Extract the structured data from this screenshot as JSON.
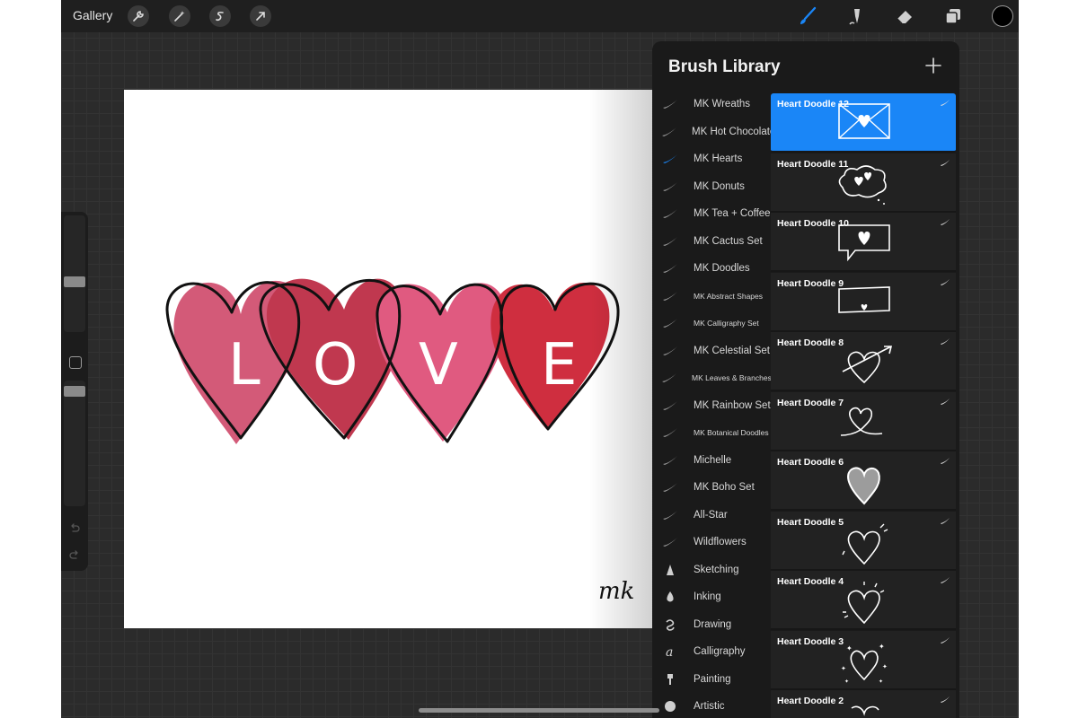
{
  "topbar": {
    "gallery_label": "Gallery",
    "left_tools": [
      "wrench-icon",
      "magic-wand-icon",
      "selection-icon",
      "transform-arrow-icon"
    ],
    "right_tools": [
      "brush-icon",
      "smudge-icon",
      "eraser-icon",
      "layers-icon"
    ],
    "active_tool": "brush-icon",
    "active_tool_color": "#1a86f7",
    "current_color": "#000000"
  },
  "sidebar": {
    "brush_size_level": 0.42,
    "opacity_level": 0.95
  },
  "canvas": {
    "artwork_letters": [
      "L",
      "O",
      "V",
      "E"
    ],
    "signature": "mk",
    "heart_colors": [
      "#d35a78",
      "#c0384f",
      "#e05a80",
      "#cf2e3f"
    ]
  },
  "library": {
    "title": "Brush Library",
    "selected_set": "MK Hearts",
    "sets": [
      {
        "label": "MK Wreaths",
        "icon": "brush-stroke-icon"
      },
      {
        "label": "MK Hot Chocolate",
        "icon": "brush-stroke-icon"
      },
      {
        "label": "MK Hearts",
        "icon": "brush-stroke-icon"
      },
      {
        "label": "MK Donuts",
        "icon": "brush-stroke-icon"
      },
      {
        "label": "MK Tea + Coffee",
        "icon": "brush-stroke-icon"
      },
      {
        "label": "MK Cactus Set",
        "icon": "brush-stroke-icon"
      },
      {
        "label": "MK Doodles",
        "icon": "brush-stroke-icon"
      },
      {
        "label": "MK Abstract Shapes",
        "icon": "brush-stroke-icon"
      },
      {
        "label": "MK Calligraphy Set",
        "icon": "brush-stroke-icon"
      },
      {
        "label": "MK Celestial Set",
        "icon": "brush-stroke-icon"
      },
      {
        "label": "MK Leaves & Branches",
        "icon": "brush-stroke-icon"
      },
      {
        "label": "MK Rainbow Set",
        "icon": "brush-stroke-icon"
      },
      {
        "label": "MK Botanical Doodles",
        "icon": "brush-stroke-icon"
      },
      {
        "label": "Michelle",
        "icon": "brush-stroke-icon"
      },
      {
        "label": "MK Boho Set",
        "icon": "brush-stroke-icon"
      },
      {
        "label": "All-Star",
        "icon": "brush-stroke-icon"
      },
      {
        "label": "Wildflowers",
        "icon": "brush-stroke-icon"
      },
      {
        "label": "Sketching",
        "icon": "pencil-tip-icon"
      },
      {
        "label": "Inking",
        "icon": "ink-drop-icon"
      },
      {
        "label": "Drawing",
        "icon": "squiggle-icon"
      },
      {
        "label": "Calligraphy",
        "icon": "letter-a-icon"
      },
      {
        "label": "Painting",
        "icon": "paint-brush-icon"
      },
      {
        "label": "Artistic",
        "icon": "palette-icon"
      }
    ],
    "selected_brush": "Heart Doodle 12",
    "brushes": [
      {
        "name": "Heart Doodle 12",
        "art": "envelope-heart"
      },
      {
        "name": "Heart Doodle 11",
        "art": "cloud-hearts"
      },
      {
        "name": "Heart Doodle 10",
        "art": "speech-bubble-heart"
      },
      {
        "name": "Heart Doodle 9",
        "art": "banner-heart"
      },
      {
        "name": "Heart Doodle 8",
        "art": "heart-arrow"
      },
      {
        "name": "Heart Doodle 7",
        "art": "heart-swirl"
      },
      {
        "name": "Heart Doodle 6",
        "art": "heart-filled-gray"
      },
      {
        "name": "Heart Doodle 5",
        "art": "heart-outline-lines"
      },
      {
        "name": "Heart Doodle 4",
        "art": "heart-sparks"
      },
      {
        "name": "Heart Doodle 3",
        "art": "heart-stars"
      },
      {
        "name": "Heart Doodle 2",
        "art": "heart-partial"
      }
    ]
  }
}
